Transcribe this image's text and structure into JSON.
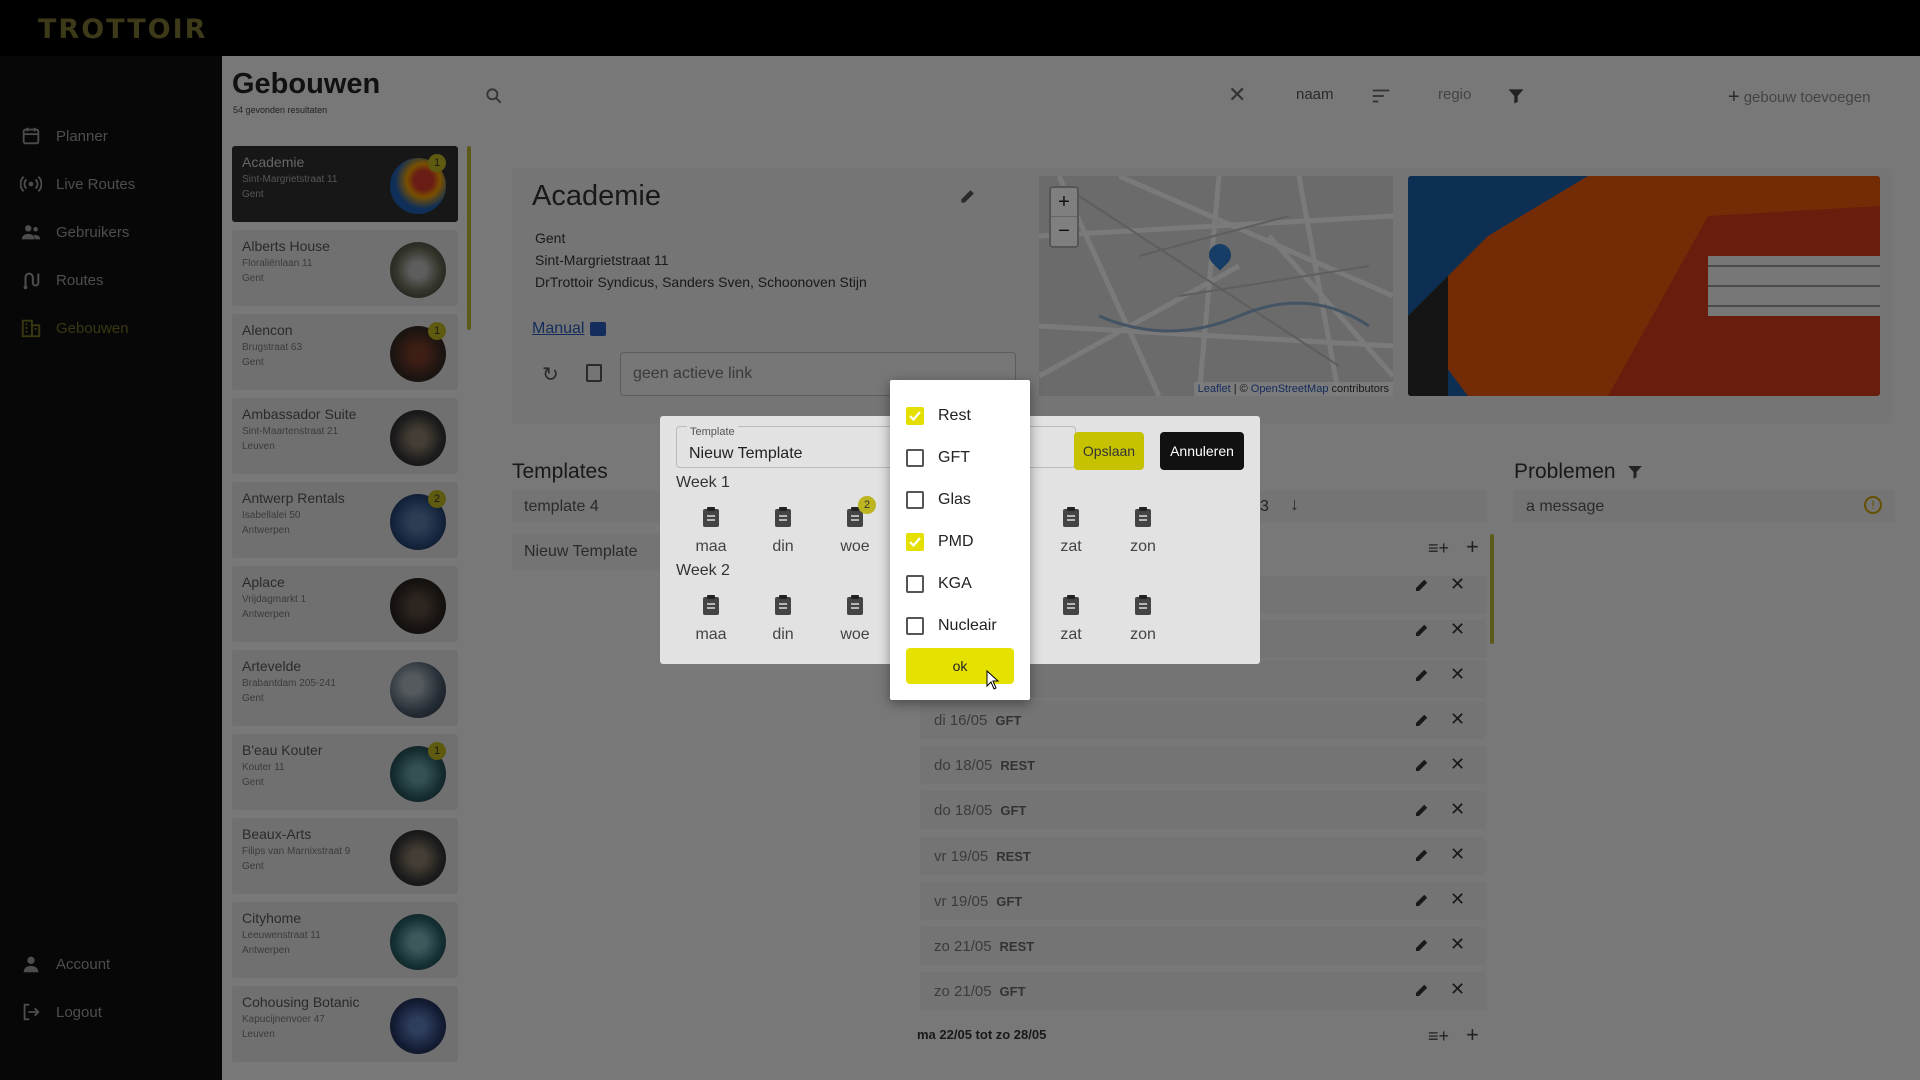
{
  "app": {
    "logo": "TROTTOIR"
  },
  "nav": {
    "items": [
      {
        "label": "Planner",
        "icon": "calendar-icon"
      },
      {
        "label": "Live Routes",
        "icon": "broadcast-icon"
      },
      {
        "label": "Gebruikers",
        "icon": "users-icon"
      },
      {
        "label": "Routes",
        "icon": "route-icon"
      },
      {
        "label": "Gebouwen",
        "icon": "buildings-icon",
        "active": true
      }
    ],
    "bottom": [
      {
        "label": "Account",
        "icon": "person-icon"
      },
      {
        "label": "Logout",
        "icon": "logout-icon"
      }
    ]
  },
  "page": {
    "title": "Gebouwen",
    "result_count": "54 gevonden resultaten"
  },
  "toolbar": {
    "search_value": "",
    "sort_field": "naam",
    "filter_field": "regio",
    "add_label": "gebouw toevoegen"
  },
  "buildings": [
    {
      "name": "Academie",
      "street": "Sint-Margrietstraat 11",
      "city": "Gent",
      "badge": "1"
    },
    {
      "name": "Alberts House",
      "street": "Floraliënlaan 11",
      "city": "Gent",
      "badge": ""
    },
    {
      "name": "Alencon",
      "street": "Brugstraat 63",
      "city": "Gent",
      "badge": "1"
    },
    {
      "name": "Ambassador Suite",
      "street": "Sint-Maartenstraat 21",
      "city": "Leuven",
      "badge": ""
    },
    {
      "name": "Antwerp Rentals",
      "street": "Isabellalei 50",
      "city": "Antwerpen",
      "badge": "2"
    },
    {
      "name": "Aplace",
      "street": "Vrijdagmarkt 1",
      "city": "Antwerpen",
      "badge": ""
    },
    {
      "name": "Artevelde",
      "street": "Brabantdam 205-241",
      "city": "Gent",
      "badge": ""
    },
    {
      "name": "B'eau Kouter",
      "street": "Kouter 11",
      "city": "Gent",
      "badge": "1"
    },
    {
      "name": "Beaux-Arts",
      "street": "Filips van Marnixstraat 9",
      "city": "Gent",
      "badge": ""
    },
    {
      "name": "Cityhome",
      "street": "Leeuwenstraat 11",
      "city": "Antwerpen",
      "badge": ""
    },
    {
      "name": "Cohousing Botanic",
      "street": "Kapucijnenvoer 47",
      "city": "Leuven",
      "badge": ""
    }
  ],
  "detail": {
    "name": "Academie",
    "city": "Gent",
    "street": "Sint-Margrietstraat 11",
    "syndicus": "DrTrottoir Syndicus, Sanders Sven, Schoonoven Stijn",
    "manual_label": "Manual",
    "link_placeholder": "geen actieve link",
    "map_attribution_leaflet": "Leaflet",
    "map_attribution_osm": "OpenStreetMap",
    "map_attribution_suffix": "contributors",
    "map_attribution_sep": "| ©"
  },
  "templates": {
    "title": "Templates",
    "items": [
      "template 4",
      "Nieuw Template"
    ],
    "week_suffix": "3"
  },
  "problems": {
    "title": "Problemen",
    "items": [
      "a message"
    ]
  },
  "schedule": {
    "rows": [
      {
        "date": "di 16/05",
        "type": "GFT"
      },
      {
        "date": "do 18/05",
        "type": "REST"
      },
      {
        "date": "do 18/05",
        "type": "GFT"
      },
      {
        "date": "vr 19/05",
        "type": "REST"
      },
      {
        "date": "vr 19/05",
        "type": "GFT"
      },
      {
        "date": "zo 21/05",
        "type": "REST"
      },
      {
        "date": "zo 21/05",
        "type": "GFT"
      }
    ],
    "next_week": "ma 22/05 tot zo 28/05"
  },
  "dialog": {
    "field_label": "Template",
    "field_value": "Nieuw Template",
    "save_label": "Opslaan",
    "cancel_label": "Annuleren",
    "week1": "Week 1",
    "week2": "Week 2",
    "days": [
      "maa",
      "din",
      "woe",
      "zat",
      "zon"
    ],
    "woe_badge": "2"
  },
  "dropdown": {
    "options": [
      {
        "label": "Rest",
        "checked": true
      },
      {
        "label": "GFT",
        "checked": false
      },
      {
        "label": "Glas",
        "checked": false
      },
      {
        "label": "PMD",
        "checked": true
      },
      {
        "label": "KGA",
        "checked": false
      },
      {
        "label": "Nucleair",
        "checked": false
      }
    ],
    "ok_label": "ok"
  },
  "colors": {
    "accent": "#e5e100",
    "badge": "#bdb51f"
  }
}
